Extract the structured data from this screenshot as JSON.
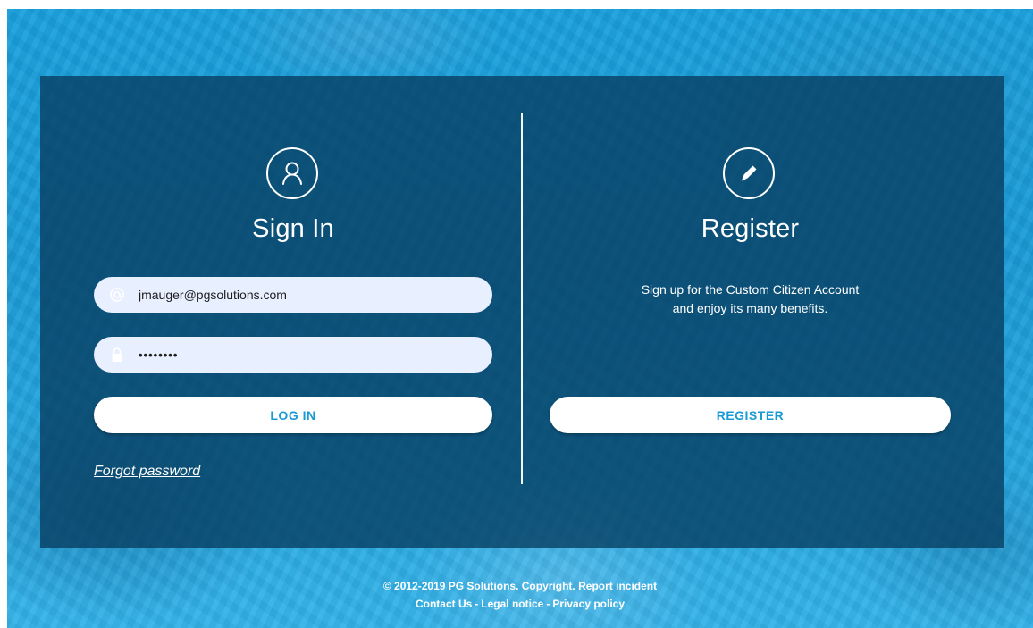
{
  "signin": {
    "heading": "Sign In",
    "email_value": "jmauger@pgsolutions.com",
    "email_icon": "at-icon",
    "password_value": "password",
    "password_icon": "lock-icon",
    "login_label": "LOG IN",
    "forgot_label": "Forgot password",
    "header_icon": "user-icon"
  },
  "register": {
    "heading": "Register",
    "blurb_line1": "Sign up for the Custom Citizen Account",
    "blurb_line2": "and enjoy its many benefits.",
    "register_label": "REGISTER",
    "header_icon": "pencil-icon"
  },
  "footer": {
    "copyright": "© 2012-2019 PG Solutions. Copyright.",
    "report_incident": "Report incident",
    "contact_us": "Contact Us",
    "separator": "-",
    "legal_notice": "Legal notice",
    "privacy_policy": "Privacy policy"
  },
  "colors": {
    "accent": "#1a9ad4",
    "panel": "#083e62",
    "input_bg": "#e8efff"
  }
}
